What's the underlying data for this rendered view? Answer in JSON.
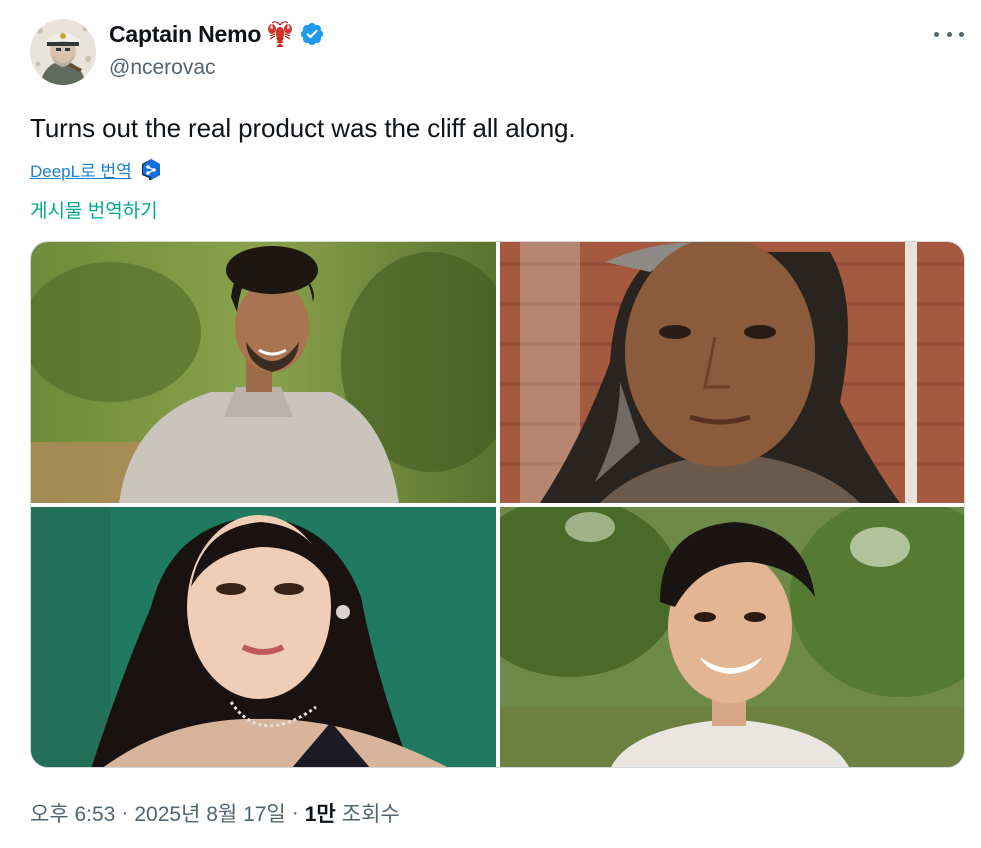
{
  "author": {
    "display_name": "Captain Nemo",
    "emoji_icon": "lobster-emoji",
    "badge_icon": "verified-badge-icon",
    "handle": "@ncerovac"
  },
  "tweet": {
    "text": "Turns out the real product was the cliff all along."
  },
  "translation": {
    "deepl_label": "DeepL로 번역",
    "translate_post_label": "게시물 번역하기"
  },
  "media": {
    "photos": [
      {
        "icon": "photo-man-curly-hair-sweater"
      },
      {
        "icon": "photo-man-long-hair-brick-wall"
      },
      {
        "icon": "photo-woman-green-background"
      },
      {
        "icon": "photo-man-smiling-trees"
      }
    ]
  },
  "meta": {
    "time": "오후 6:53",
    "date": "2025년 8월 17일",
    "views_count": "1만",
    "views_label": "조회수"
  },
  "colors": {
    "accent": "#1d9bf0",
    "translate_link": "#00a98f",
    "secondary_text": "#536471"
  }
}
